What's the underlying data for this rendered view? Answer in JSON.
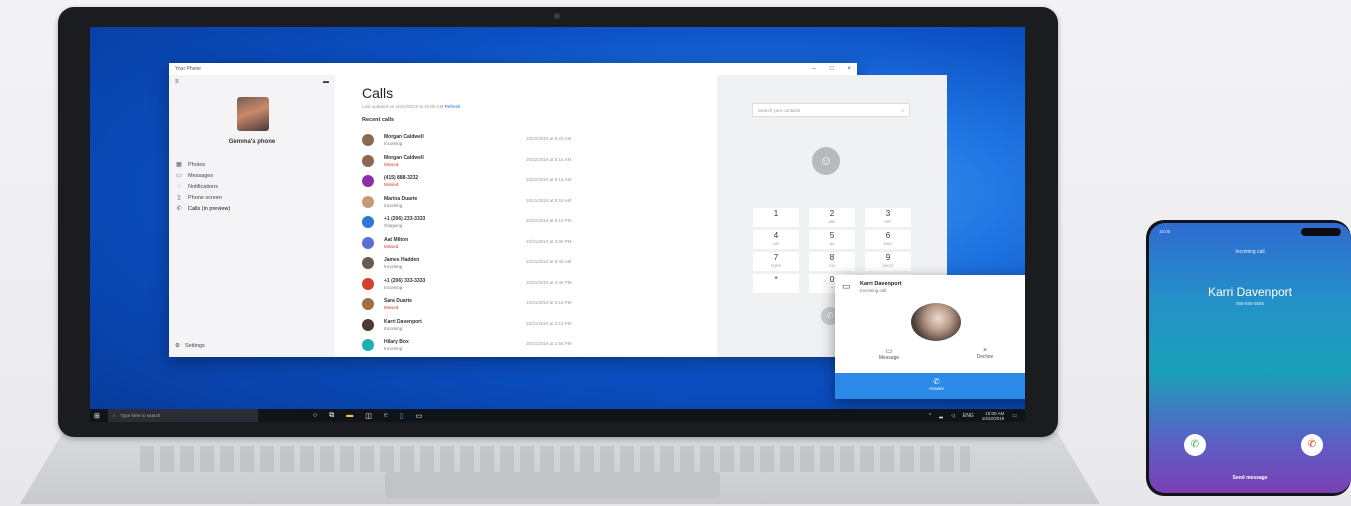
{
  "window": {
    "title": "Your Phone",
    "controls": [
      "–",
      "□",
      "×"
    ]
  },
  "sidebar": {
    "menu_icon": "≡",
    "battery_icon": "▬",
    "device_name": "Gemma's phone",
    "items": [
      {
        "label": "Photos",
        "icon": "photos-icon",
        "glyph": "▦"
      },
      {
        "label": "Messages",
        "icon": "messages-icon",
        "glyph": "▭"
      },
      {
        "label": "Notifications",
        "icon": "notifications-icon",
        "glyph": "◌"
      },
      {
        "label": "Phone screen",
        "icon": "phone-screen-icon",
        "glyph": "▯"
      },
      {
        "label": "Calls (in preview)",
        "icon": "calls-icon",
        "glyph": "✆"
      }
    ],
    "settings_label": "Settings"
  },
  "calls": {
    "title": "Calls",
    "last_updated": "Last updated on 10/22/2019 at 10:00 AM",
    "refresh_label": "Refresh",
    "recent_label": "Recent calls",
    "items": [
      {
        "name": "Morgan Caldwell",
        "type": "Incoming",
        "missed": false,
        "time": "10/22/2019 at 9:23 AM",
        "color": "#8a6a52"
      },
      {
        "name": "Morgan Caldwell",
        "type": "Missed",
        "missed": true,
        "time": "10/22/2019 at 9:15 AM",
        "color": "#8a6a52"
      },
      {
        "name": "(415) 888-3232",
        "type": "Missed",
        "missed": true,
        "time": "10/22/2019 at 8:14 AM",
        "color": "#8e2fa8"
      },
      {
        "name": "Marina Duarte",
        "type": "Incoming",
        "missed": false,
        "time": "10/21/2019 at 8:53 AM",
        "color": "#c59a7a"
      },
      {
        "name": "+1 (206) 233-3333",
        "type": "Outgoing",
        "missed": false,
        "time": "10/21/2019 at 8:10 PM",
        "color": "#2a78d6"
      },
      {
        "name": "Aat Milton",
        "type": "Missed",
        "missed": true,
        "time": "10/21/2019 at 3:06 PM",
        "color": "#5a6fd6"
      },
      {
        "name": "James Hadden",
        "type": "Incoming",
        "missed": false,
        "time": "10/21/2019 at 8:42 AM",
        "color": "#6b5a4a"
      },
      {
        "name": "+1 (206) 333-3333",
        "type": "Incoming",
        "missed": false,
        "time": "10/21/2019 at 3:48 PM",
        "color": "#d6402a"
      },
      {
        "name": "Sara Duarte",
        "type": "Missed",
        "missed": true,
        "time": "10/21/2019 at 3:16 PM",
        "color": "#a0704a"
      },
      {
        "name": "Karri Davenport",
        "type": "Incoming",
        "missed": false,
        "time": "10/21/2019 at 3:13 PM",
        "color": "#4a3a32"
      },
      {
        "name": "Hilary Box",
        "type": "Incoming",
        "missed": false,
        "time": "10/21/2019 at 2:56 PM",
        "color": "#19b0b8"
      }
    ]
  },
  "dialer": {
    "search_placeholder": "Search your contacts",
    "keys": [
      {
        "digit": "1",
        "letters": ""
      },
      {
        "digit": "2",
        "letters": "ABC"
      },
      {
        "digit": "3",
        "letters": "DEF"
      },
      {
        "digit": "4",
        "letters": "GHI"
      },
      {
        "digit": "5",
        "letters": "JKL"
      },
      {
        "digit": "6",
        "letters": "MNO"
      },
      {
        "digit": "7",
        "letters": "PQRS"
      },
      {
        "digit": "8",
        "letters": "TUV"
      },
      {
        "digit": "9",
        "letters": "WXYZ"
      },
      {
        "digit": "*",
        "letters": ""
      },
      {
        "digit": "0",
        "letters": "+"
      },
      {
        "digit": "#",
        "letters": ""
      }
    ]
  },
  "incoming_popup": {
    "name": "Karri Davenport",
    "subtitle": "Incoming call",
    "message_label": "Message",
    "decline_label": "Decline",
    "answer_label": "Answer"
  },
  "taskbar": {
    "search_placeholder": "Type here to search",
    "time": "10:00 AM",
    "date": "10/22/2019"
  },
  "phone": {
    "status_time": "10:00",
    "incoming_label": "Incoming call",
    "caller_name": "Karri Davenport",
    "caller_number": "555-555-5555",
    "send_message_label": "Send message"
  }
}
